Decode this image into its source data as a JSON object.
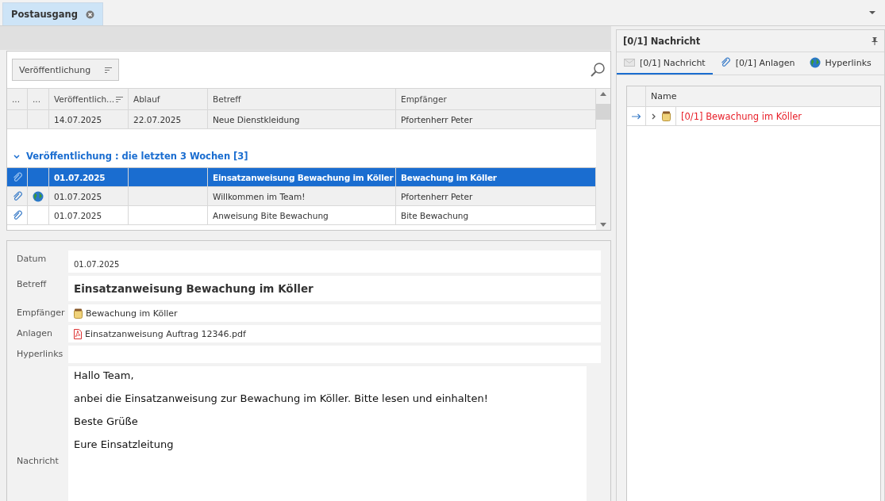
{
  "tab": {
    "title": "Postausgang",
    "selected": true
  },
  "grid": {
    "group_chip": "Veröffentlichung",
    "columns": [
      {
        "label": "...",
        "sorted": false
      },
      {
        "label": "...",
        "sorted": false
      },
      {
        "label": "Veröffentlich...",
        "sorted": true
      },
      {
        "label": "Ablauf",
        "sorted": false
      },
      {
        "label": "Betreff",
        "sorted": false
      },
      {
        "label": "Empfänger",
        "sorted": false
      }
    ],
    "rows": [
      {
        "attachment": false,
        "link": false,
        "date": "14.07.2025",
        "expiry": "22.07.2025",
        "subject": "Neue Dienstkleidung",
        "recipient": "Pfortenherr Peter",
        "selected": false
      }
    ],
    "group": {
      "label": "Veröffentlichung : die letzten 3 Wochen [3]",
      "expanded": true,
      "rows": [
        {
          "attachment": true,
          "link": false,
          "date": "01.07.2025",
          "subject": "Einsatzanweisung Bewachung im Köller",
          "recipient": "Bewachung im Köller",
          "selected": true
        },
        {
          "attachment": true,
          "link": true,
          "date": "01.07.2025",
          "subject": "Willkommen im Team!",
          "recipient": "Pfortenherr Peter",
          "selected": false
        },
        {
          "attachment": true,
          "link": false,
          "date": "01.07.2025",
          "subject": "Anweisung Bite Bewachung",
          "recipient": "Bite Bewachung",
          "selected": false
        }
      ]
    }
  },
  "detail": {
    "fields": [
      {
        "label": "Datum",
        "kind": "date",
        "value": "01.07.2025"
      },
      {
        "label": "Betreff",
        "kind": "subject",
        "value": "Einsatzanweisung Bewachung im Köller"
      },
      {
        "label": "Empfänger",
        "kind": "recipient",
        "value": "Bewachung im Köller"
      },
      {
        "label": "Anlagen",
        "kind": "pdf",
        "value": "Einsatzanweisung Auftrag 12346.pdf"
      },
      {
        "label": "Hyperlinks",
        "kind": "empty"
      }
    ],
    "message": {
      "label": "Nachricht",
      "paragraphs": [
        "Hallo Team,",
        "anbei die Einsatzanweisung zur Bewachung im Köller. Bitte lesen und einhalten!",
        "Beste Grüße",
        "Eure Einsatzleitung"
      ]
    }
  },
  "side": {
    "title": "[0/1] Nachricht",
    "tabs": [
      {
        "label": "[0/1] Nachricht",
        "kind": "message",
        "selected": true
      },
      {
        "label": "[0/1] Anlagen",
        "kind": "attachments",
        "selected": false
      },
      {
        "label": "Hyperlinks",
        "kind": "links",
        "selected": false
      }
    ],
    "tree": {
      "column": "Name",
      "rows": [
        {
          "label": "[0/1] Bewachung im Köller",
          "focused": true,
          "expanded": false
        }
      ]
    }
  }
}
